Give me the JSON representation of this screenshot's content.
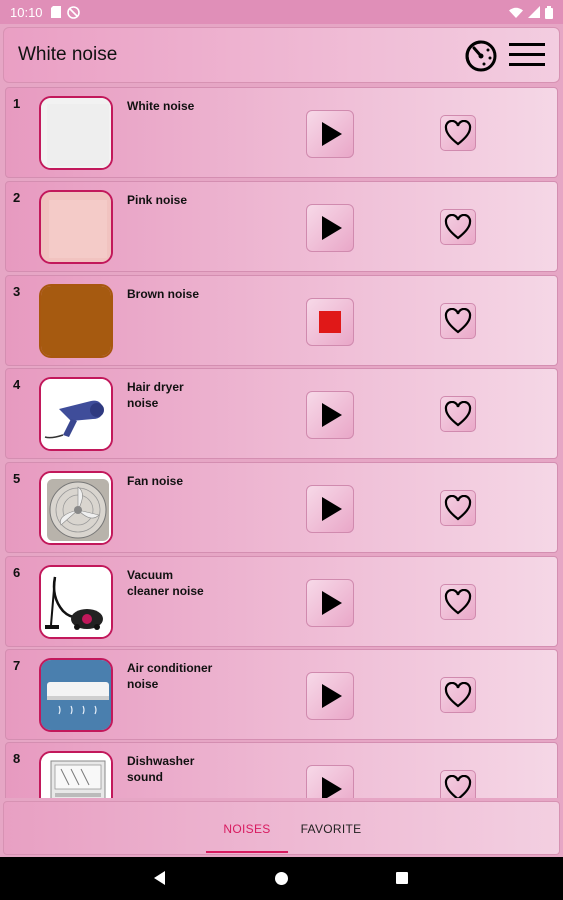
{
  "status_bar": {
    "time": "10:10"
  },
  "app_bar": {
    "title": "White noise",
    "timer_icon": "timer-icon",
    "menu_icon": "menu-icon"
  },
  "noises": [
    {
      "index": "1",
      "title": "White noise",
      "state": "play"
    },
    {
      "index": "2",
      "title": "Pink noise",
      "state": "play"
    },
    {
      "index": "3",
      "title": "Brown noise",
      "state": "stop"
    },
    {
      "index": "4",
      "title": "Hair dryer noise",
      "state": "play"
    },
    {
      "index": "5",
      "title": "Fan noise",
      "state": "play"
    },
    {
      "index": "6",
      "title": "Vacuum cleaner noise",
      "state": "play"
    },
    {
      "index": "7",
      "title": "Air conditioner noise",
      "state": "play"
    },
    {
      "index": "8",
      "title": "Dishwasher sound",
      "state": "play"
    }
  ],
  "tabs": {
    "noises": "NOISES",
    "favorite": "FAVORITE",
    "selected": "NOISES"
  },
  "colors": {
    "accent": "#d81b60",
    "stop": "#e01818",
    "status_bar": "#e08fb8"
  }
}
